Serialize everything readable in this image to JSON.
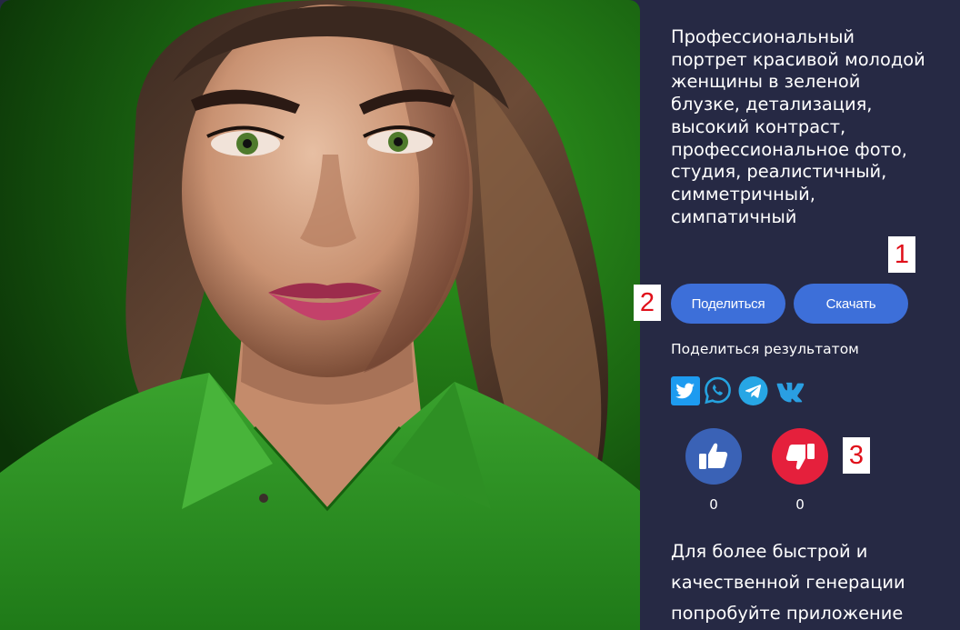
{
  "theme": {
    "background": "#262944",
    "button": "#3d6fd9",
    "like": "#3a62b6",
    "dislike": "#e5203c"
  },
  "image": {
    "alt": "portrait-of-woman-in-green-blouse"
  },
  "prompt": "Профессиональный портрет красивой молодой женщины в зеленой блузке, детализация, высокий контраст, профессиональное фото, студия, реалистичный, симметричный, симпатичный",
  "markers": {
    "m1": "1",
    "m2": "2",
    "m3": "3"
  },
  "buttons": {
    "share": "Поделиться",
    "download": "Скачать"
  },
  "share_section": {
    "title": "Поделиться результатом",
    "networks": [
      {
        "name": "twitter-icon",
        "color": "#1d9bf0"
      },
      {
        "name": "whatsapp-icon",
        "color": "#25a3e0"
      },
      {
        "name": "telegram-icon",
        "color": "#27a6e5"
      },
      {
        "name": "vk-icon",
        "color": "#2a9fe2"
      }
    ]
  },
  "votes": {
    "likes": "0",
    "dislikes": "0"
  },
  "promo": "Для более быстрой и качественной генерации попробуйте приложение"
}
